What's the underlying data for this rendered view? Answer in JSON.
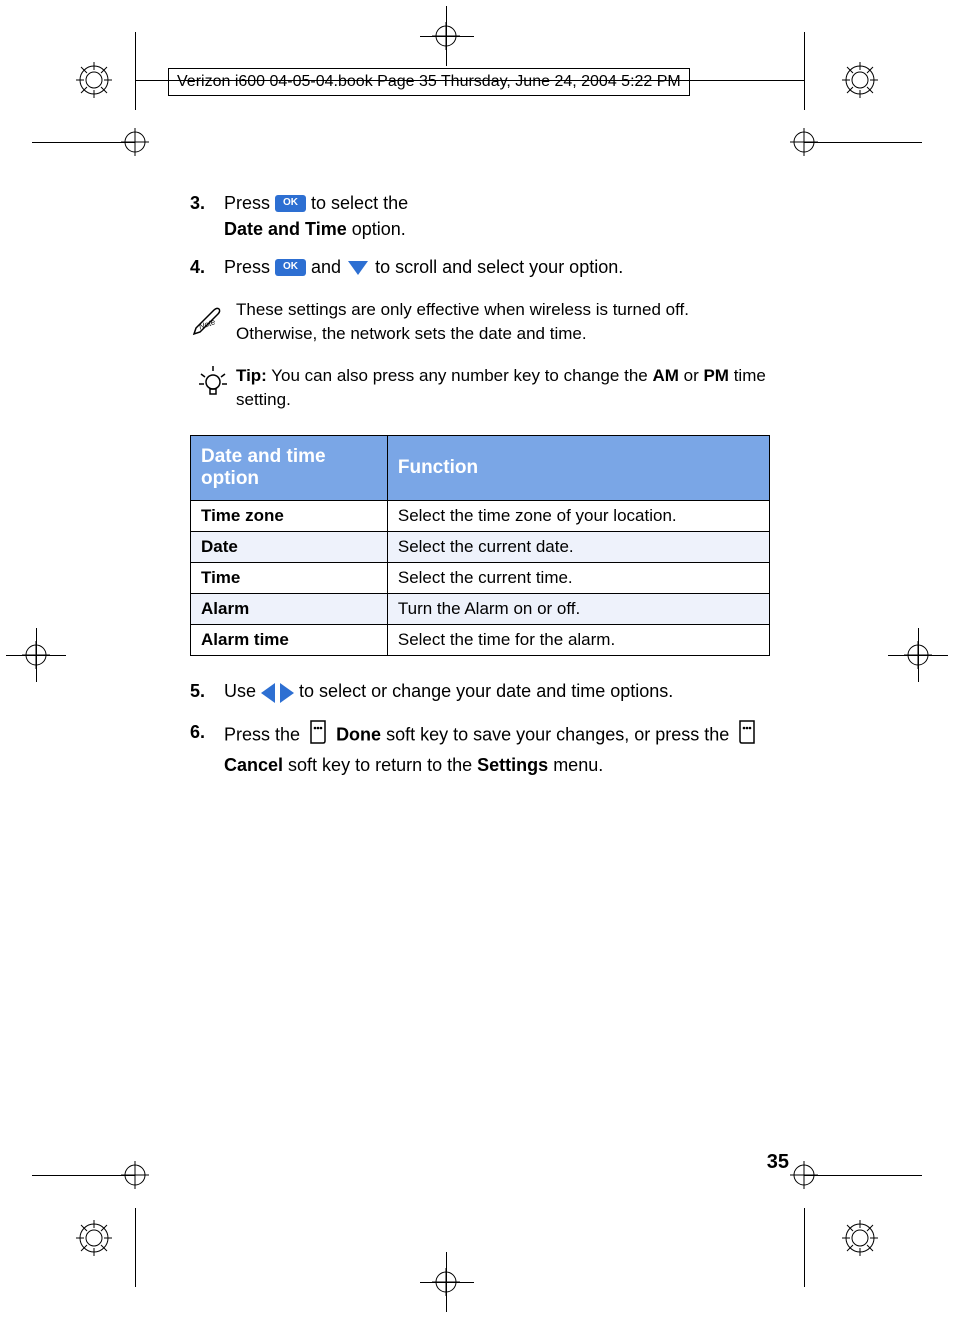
{
  "running_header": "Verizon i600 04-05-04.book  Page 35  Thursday, June 24, 2004  5:22 PM",
  "page_number": "35",
  "ok_label": "OK",
  "steps": {
    "s3": {
      "num": "3.",
      "pre": "Press ",
      "post1": " to select the",
      "line2_bold": "Date and Time",
      "line2_rest": " option."
    },
    "s4": {
      "num": "4.",
      "pre": "Press ",
      "mid": " and ",
      "post": " to scroll and select your option."
    },
    "s5": {
      "num": "5.",
      "pre": "Use ",
      "post": " to select or change your date and time options."
    },
    "s6": {
      "num": "6.",
      "pre": "Press the ",
      "done": "Done",
      "mid1": " soft key to save your changes, or press the ",
      "cancel": "Cancel",
      "mid2": " soft key to return to the ",
      "settings": "Settings",
      "post": " menu."
    }
  },
  "note_text": "These settings are only effective when wireless is turned off. Otherwise, the network sets the date and time.",
  "tip_label": "Tip:",
  "tip_text_before": " You can also press any number key to change the ",
  "tip_am": "AM",
  "tip_sep": " or ",
  "tip_pm": "PM",
  "tip_text_after": " time setting.",
  "table": {
    "headers": {
      "c1": "Date and time option",
      "c2": "Function"
    },
    "rows": [
      {
        "c1": "Time zone",
        "c2": "Select the time zone of your location."
      },
      {
        "c1": "Date",
        "c2": "Select the current date."
      },
      {
        "c1": "Time",
        "c2": "Select the current time."
      },
      {
        "c1": "Alarm",
        "c2": "Turn the Alarm on or off."
      },
      {
        "c1": "Alarm time",
        "c2": "Select the time for the alarm."
      }
    ]
  }
}
